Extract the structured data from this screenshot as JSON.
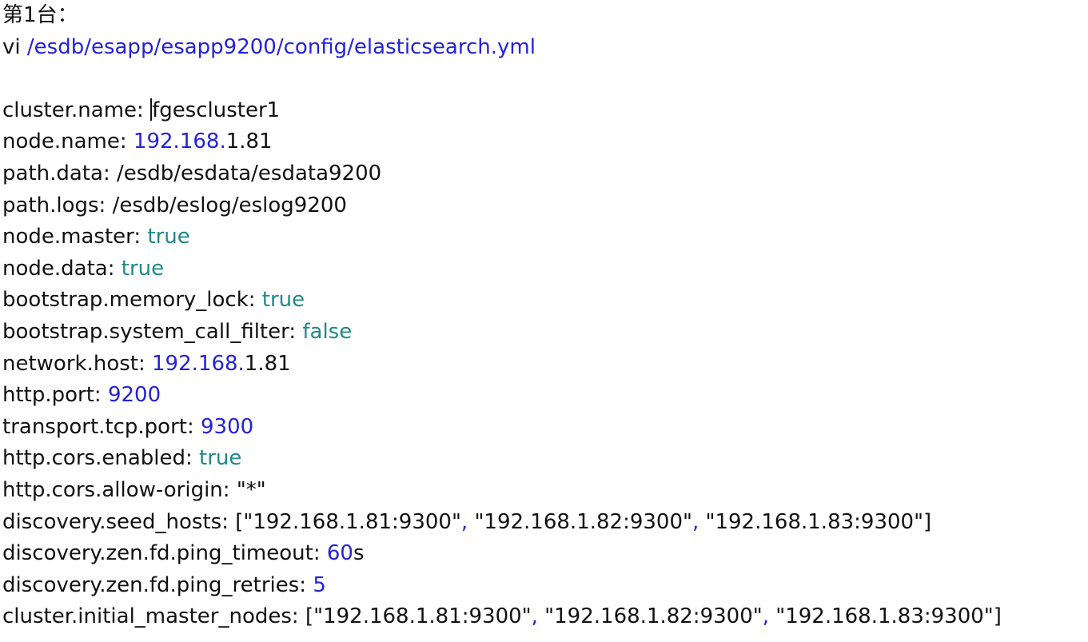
{
  "heading": "第1台：",
  "command": {
    "prefix": "vi",
    "path": "/esdb/esapp/esapp9200/config/elasticsearch.yml"
  },
  "config": {
    "cluster_name": {
      "key": "cluster.name:",
      "value": "fgescluster1"
    },
    "node_name": {
      "key": "node.name:",
      "value_blue": "192.168.",
      "value_rest": "1.81"
    },
    "path_data": {
      "key": "path.data:",
      "value": "/esdb/esdata/esdata9200"
    },
    "path_logs": {
      "key": "path.logs:",
      "value": "/esdb/eslog/eslog9200"
    },
    "node_master": {
      "key": "node.master:",
      "value": "true"
    },
    "node_data": {
      "key": "node.data:",
      "value": "true"
    },
    "memory_lock": {
      "key": "bootstrap.memory_lock:",
      "value": "true"
    },
    "system_call_filter": {
      "key": "bootstrap.system_call_filter:",
      "value": "false"
    },
    "network_host": {
      "key": "network.host:",
      "value_blue": "192.168.",
      "value_rest": "1.81"
    },
    "http_port": {
      "key": "http.port:",
      "value": "9200"
    },
    "transport_port": {
      "key": "transport.tcp.port:",
      "value": "9300"
    },
    "cors_enabled": {
      "key": "http.cors.enabled:",
      "value": "true"
    },
    "cors_allow_origin": {
      "key": "http.cors.allow-origin:",
      "value": "\"*\""
    },
    "seed_hosts": {
      "key": "discovery.seed_hosts:",
      "open": "[",
      "items": [
        "\"192.168.1.81:9300\"",
        "\"192.168.1.82:9300\"",
        "\"192.168.1.83:9300\""
      ],
      "close": "]"
    },
    "ping_timeout": {
      "key": "discovery.zen.fd.ping_timeout:",
      "value_blue": "60",
      "value_rest": "s"
    },
    "ping_retries": {
      "key": "discovery.zen.fd.ping_retries:",
      "value": "5"
    },
    "initial_master_nodes": {
      "key": "cluster.initial_master_nodes:",
      "open": "[",
      "items": [
        "\"192.168.1.81:9300\"",
        "\"192.168.1.82:9300\"",
        "\"192.168.1.83:9300\""
      ],
      "close": "]"
    }
  },
  "colors": {
    "text": "#111111",
    "number": "#2323d6",
    "boolean": "#1f8a86"
  }
}
